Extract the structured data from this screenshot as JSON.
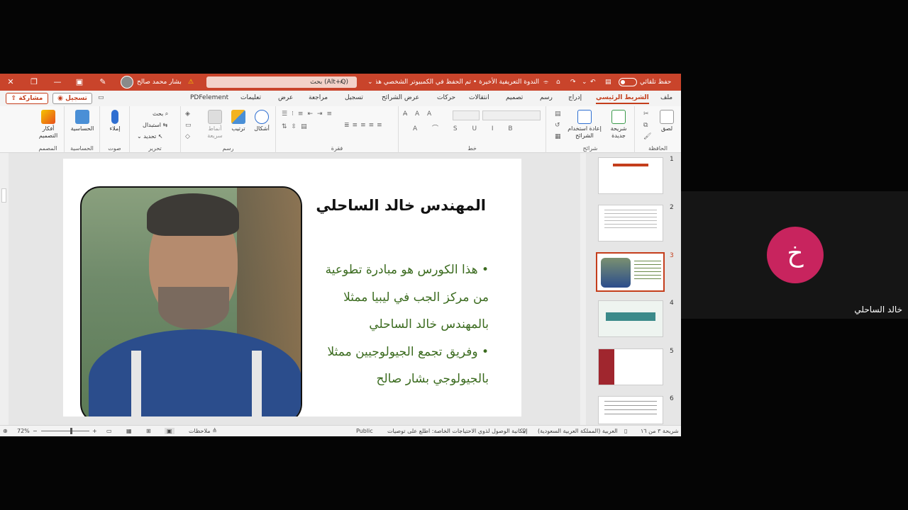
{
  "window": {
    "autosave_label": "حفظ تلقائي",
    "document_title": "الندوة التعريفية الأخيرة • تم الحفظ في الكمبيوتر الشخصي هذا",
    "search_placeholder": "بحث (Alt+Q)",
    "user_name": "بشار محمد  صالح",
    "accent_color": "#c43e1c"
  },
  "tabs": [
    "ملف",
    "الشريط الرئيسي",
    "إدراج",
    "رسم",
    "تصميم",
    "انتقالات",
    "حركات",
    "عرض الشرائح",
    "تسجيل",
    "مراجعة",
    "عرض",
    "تعليمات",
    "PDFelement"
  ],
  "actions": {
    "record_label": "تسجيل",
    "share_label": "مشاركة"
  },
  "ribbon": {
    "clipboard": {
      "label": "الحافظة",
      "paste": "لصق"
    },
    "slides": {
      "label": "شرائح",
      "new_slide": "شريحة جديدة",
      "reuse_slides": "إعادة استخدام الشرائح"
    },
    "font": {
      "label": "خط"
    },
    "paragraph": {
      "label": "فقرة"
    },
    "drawing": {
      "label": "رسم",
      "shapes": "أشكال",
      "arrange": "ترتيب",
      "quick_styles": "أنماط سريعة"
    },
    "editing": {
      "label": "تحرير",
      "find": "بحث",
      "replace": "استبدال",
      "select": "تحديد"
    },
    "voice": {
      "label": "صوت",
      "dictate": "إملاء"
    },
    "sensitivity": {
      "label": "الحساسية",
      "button": "الحساسية"
    },
    "designer": {
      "label": "المصمم",
      "button": "أفكار التصميم"
    }
  },
  "slide": {
    "title": "المهندس خالد الساحلي",
    "bullets": [
      [
        "• هذا الكورس هو مبادرة تطوعية",
        "من مركز الجب في ليبيا ممثلا",
        "بالمهندس خالد الساحلي"
      ],
      [
        "• وفريق تجمع الجيولوجيين  ممثلا",
        "بالجيولوجي بشار صالح"
      ]
    ]
  },
  "thumbnails": {
    "numbers": [
      "1",
      "2",
      "3",
      "4",
      "5",
      "6"
    ],
    "active_index": 3
  },
  "statusbar": {
    "slide_count": "شريحة ٣ من ١٦",
    "language": "العربية (المملكة العربية السعودية)",
    "accessibility": "إمكانية الوصول لذوي الاحتياجات الخاصة: اطلع على توصيات",
    "sensitivity": "Public",
    "notes": "ملاحظات",
    "zoom": "72%"
  },
  "meeting": {
    "participant_initial": "خ",
    "participant_name": "خالد الساحلي",
    "avatar_color": "#c8245e"
  }
}
